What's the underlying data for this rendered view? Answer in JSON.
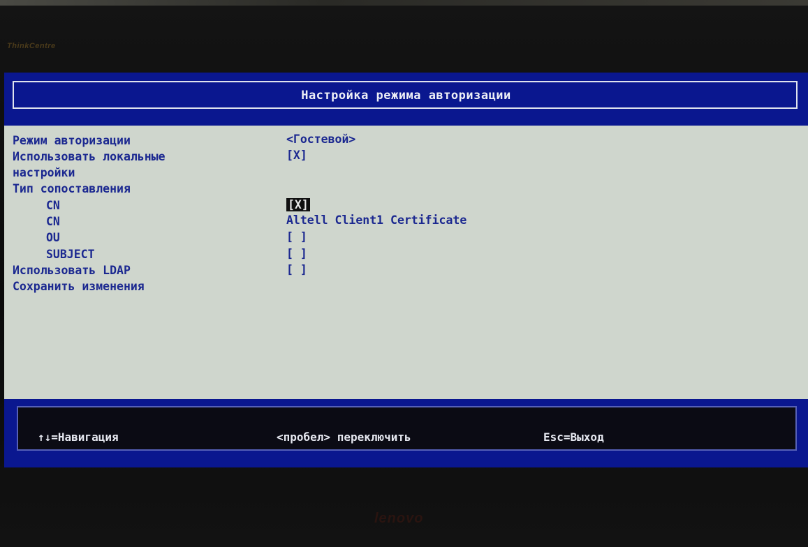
{
  "monitor": {
    "brand_top": "ThinkCentre",
    "brand_bottom": "lenovo"
  },
  "screen": {
    "title": "Настройка режима авторизации",
    "settings": [
      {
        "label": "Режим авторизации",
        "value": "<Гостевой>"
      },
      {
        "label": "Использовать локальные",
        "value": "[X]"
      },
      {
        "label": "настройки",
        "value": ""
      },
      {
        "label": "Тип сопоставления",
        "value": ""
      },
      {
        "label": "CN",
        "value": "[X]"
      },
      {
        "label": "CN",
        "value": "Altell Client1 Certificate"
      },
      {
        "label": "OU",
        "value": "[ ]"
      },
      {
        "label": "SUBJECT",
        "value": "[ ]"
      },
      {
        "label": "Использовать LDAP",
        "value": "[ ]"
      },
      {
        "label": "Сохранить изменения",
        "value": ""
      }
    ],
    "footer": {
      "navigation": "↑↓=Навигация",
      "toggle": "<пробел> переключить",
      "exit": "Esc=Выход"
    }
  },
  "colors": {
    "panel_blue": "#0a178f",
    "screen_bg": "#cfd6cd",
    "text_blue": "#1b2890"
  }
}
